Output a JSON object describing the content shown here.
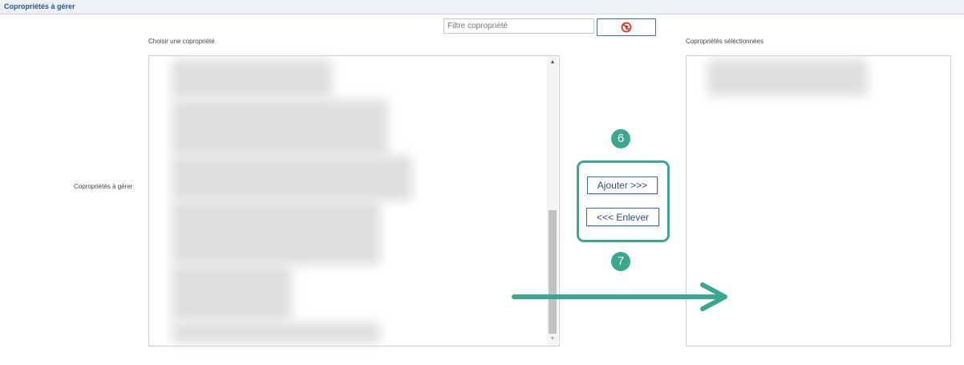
{
  "header": {
    "title": "Copropriétés à gérer"
  },
  "filter": {
    "placeholder": "Filtre copropriété",
    "value": "",
    "clear_icon": "no-filter-icon"
  },
  "available": {
    "label": "Choisir une copropriété"
  },
  "row_label": "Copropriétés à gérer",
  "selected": {
    "label": "Copropriétés séléctionnées"
  },
  "actions": {
    "add_label": "Ajouter >>>",
    "remove_label": "<<< Enlever"
  },
  "badges": {
    "step_add": "6",
    "step_move": "7"
  },
  "colors": {
    "accent": "#3aa78e",
    "button_border": "#3b6ea8",
    "header_text": "#2a5485"
  }
}
